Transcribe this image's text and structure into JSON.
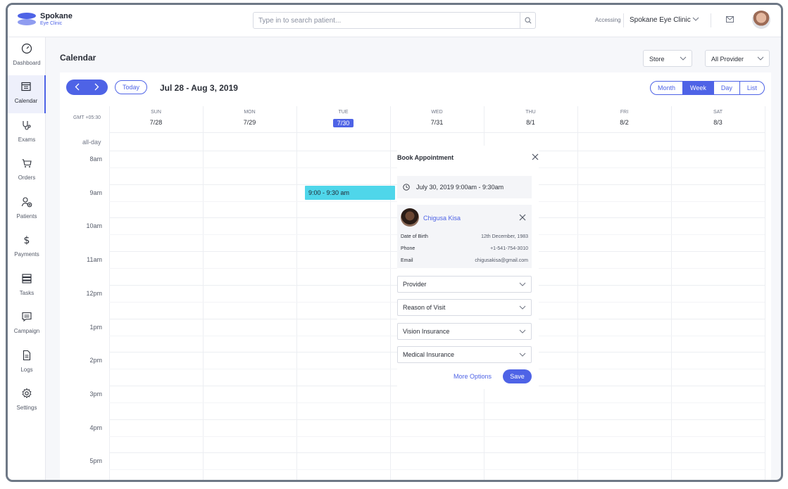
{
  "app": {
    "brand_name": "Spokane",
    "brand_sub": "Eye Clinic",
    "search_placeholder": "Type in to search patient...",
    "accessing_label": "Accessing",
    "clinic": "Spokane Eye Clinic"
  },
  "sidebar": {
    "items": [
      {
        "label": "Dashboard",
        "icon": "gauge-icon"
      },
      {
        "label": "Calendar",
        "icon": "calendar-icon",
        "active": true
      },
      {
        "label": "Exams",
        "icon": "stethoscope-icon"
      },
      {
        "label": "Orders",
        "icon": "cart-icon"
      },
      {
        "label": "Patients",
        "icon": "user-add-icon"
      },
      {
        "label": "Payments",
        "icon": "dollar-icon"
      },
      {
        "label": "Tasks",
        "icon": "tasks-icon"
      },
      {
        "label": "Campaign",
        "icon": "chat-icon"
      },
      {
        "label": "Logs",
        "icon": "document-icon"
      },
      {
        "label": "Settings",
        "icon": "gear-icon"
      }
    ]
  },
  "header": {
    "title": "Calendar",
    "store_select": "Store",
    "provider_select": "All Provider"
  },
  "calendar": {
    "today_label": "Today",
    "range": "Jul 28 - Aug 3, 2019",
    "views": [
      "Month",
      "Week",
      "Day",
      "List"
    ],
    "active_view": "Week",
    "timezone": "GMT +05:30",
    "allday_label": "all-day",
    "days": [
      {
        "name": "SUN",
        "date": "7/28"
      },
      {
        "name": "MON",
        "date": "7/29"
      },
      {
        "name": "TUE",
        "date": "7/30",
        "current": true
      },
      {
        "name": "WED",
        "date": "7/31"
      },
      {
        "name": "THU",
        "date": "8/1"
      },
      {
        "name": "FRI",
        "date": "8/2"
      },
      {
        "name": "SAT",
        "date": "8/3"
      }
    ],
    "hours": [
      "8am",
      "9am",
      "10am",
      "11am",
      "12pm",
      "1pm",
      "2pm",
      "3pm",
      "4pm",
      "5pm"
    ],
    "event": {
      "label": "9:00 - 9:30 am",
      "color": "#4fd6ea"
    }
  },
  "popup": {
    "title": "Book Appointment",
    "datetime": "July 30, 2019 9:00am - 9:30am",
    "patient": {
      "name": "Chigusa Kisa",
      "dob_label": "Date of Birth",
      "dob": "12th December, 1983",
      "phone_label": "Phone",
      "phone": "+1-541-754-3010",
      "email_label": "Email",
      "email": "chigusakisa@gmail.com"
    },
    "fields": [
      "Provider",
      "Reason of Visit",
      "Vision Insurance",
      "Medical Insurance"
    ],
    "more_options": "More Options",
    "save": "Save"
  },
  "colors": {
    "accent": "#4e63e6",
    "event": "#4fd6ea"
  }
}
